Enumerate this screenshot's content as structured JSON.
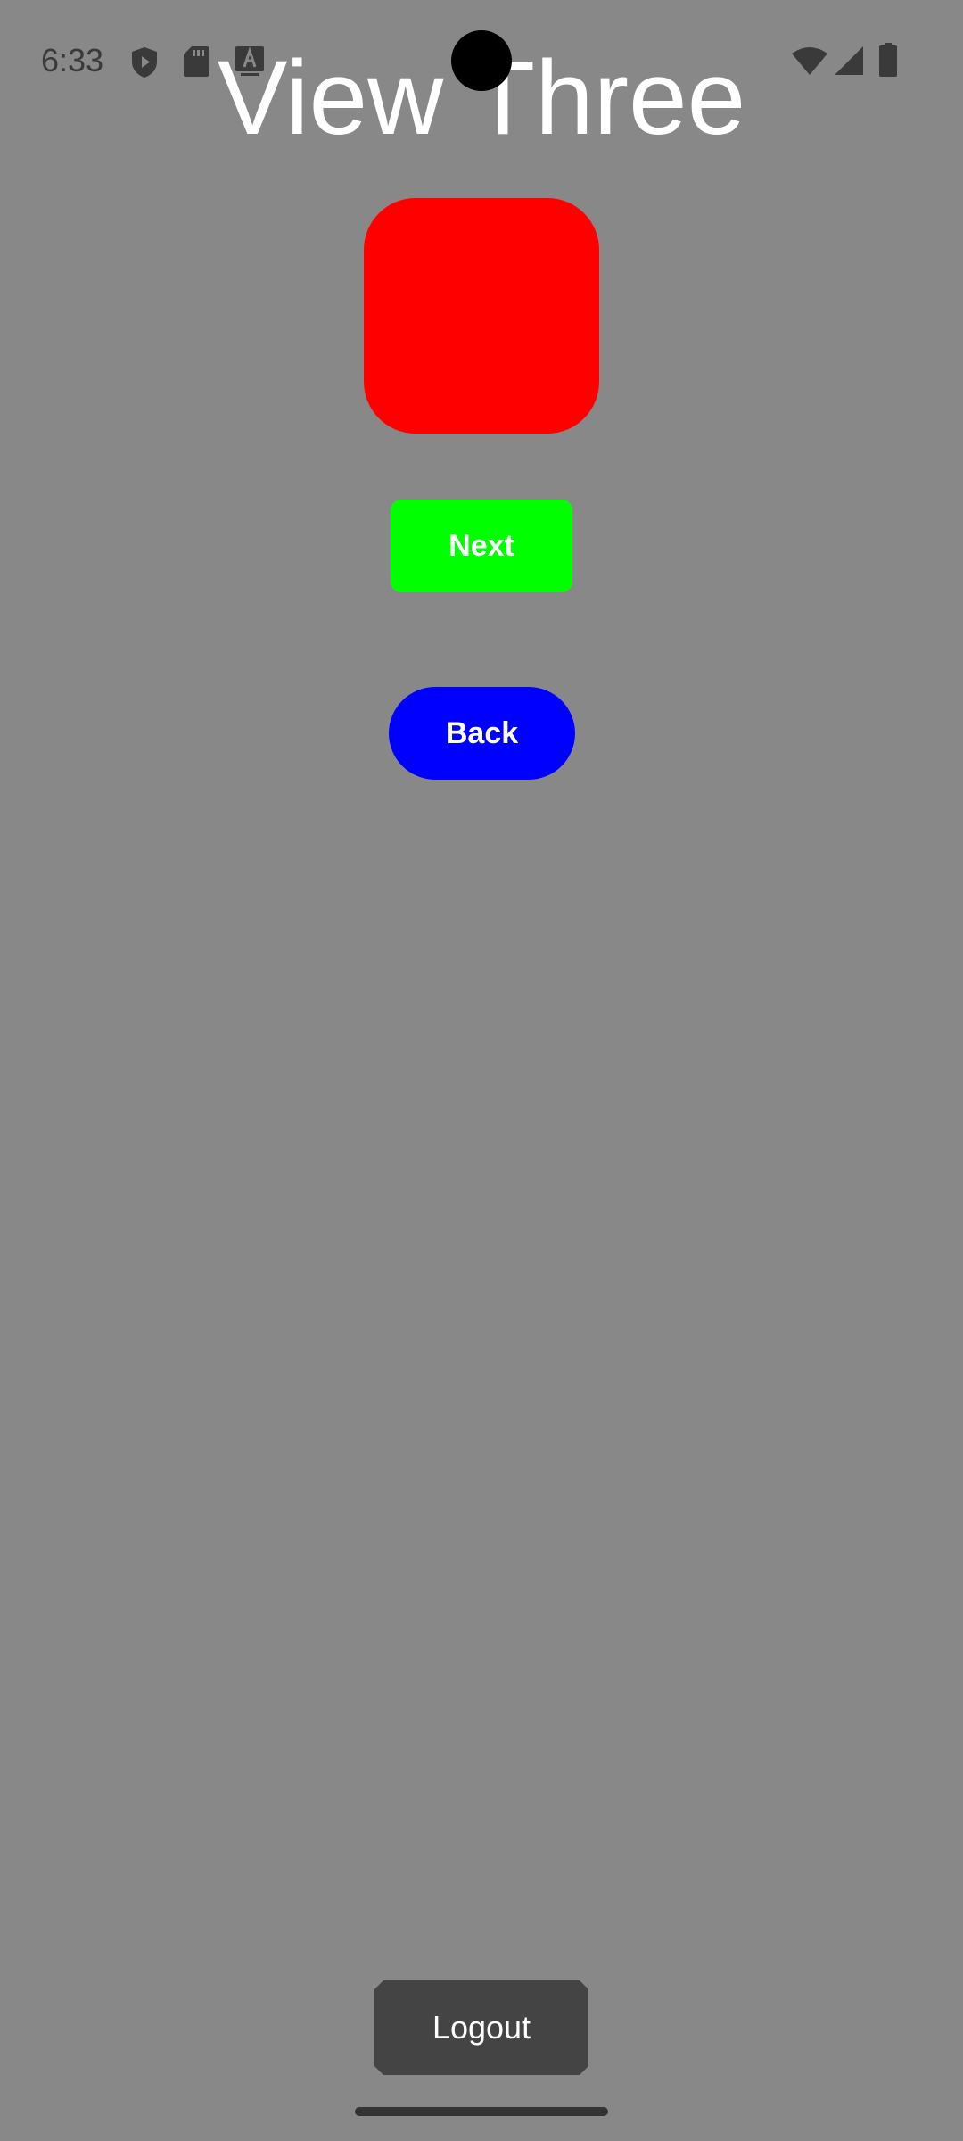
{
  "status_bar": {
    "time": "6:33",
    "left_icons": [
      "shield-play-icon",
      "sd-card-icon",
      "font-a-icon"
    ],
    "right_icons": [
      "wifi-icon",
      "cellular-signal-icon",
      "battery-icon"
    ],
    "icon_color": "#3a3a3a"
  },
  "page": {
    "title": "View Three",
    "background_color": "#888888"
  },
  "red_box": {
    "color": "#ff0000"
  },
  "buttons": {
    "next": {
      "label": "Next",
      "color": "#00ff00"
    },
    "back": {
      "label": "Back",
      "color": "#0000ff"
    },
    "logout": {
      "label": "Logout",
      "color": "#444444"
    }
  }
}
